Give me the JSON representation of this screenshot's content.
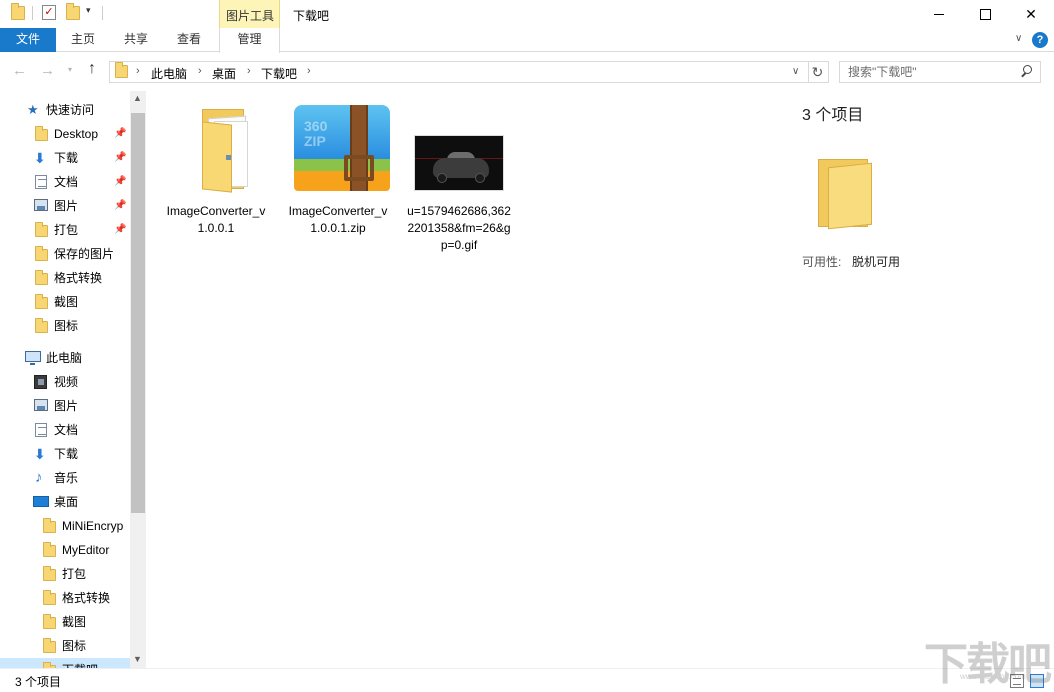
{
  "titlebar": {
    "context_tab_header": "图片工具",
    "window_title": "下载吧"
  },
  "ribbon": {
    "tabs": [
      {
        "label": "文件"
      },
      {
        "label": "主页"
      },
      {
        "label": "共享"
      },
      {
        "label": "查看"
      },
      {
        "label": "管理"
      }
    ],
    "help": "?"
  },
  "address": {
    "segments": [
      "此电脑",
      "桌面",
      "下载吧"
    ],
    "search_placeholder": "搜索\"下载吧\""
  },
  "sidebar": {
    "quick_access": {
      "label": "快速访问",
      "items": [
        {
          "label": "Desktop",
          "icon": "folder-icon",
          "pinned": true
        },
        {
          "label": "下载",
          "icon": "download-icon",
          "pinned": true
        },
        {
          "label": "文档",
          "icon": "document-icon",
          "pinned": true
        },
        {
          "label": "图片",
          "icon": "pictures-icon",
          "pinned": true
        },
        {
          "label": "打包",
          "icon": "folder-icon",
          "pinned": true
        },
        {
          "label": "保存的图片",
          "icon": "folder-icon",
          "pinned": false
        },
        {
          "label": "格式转换",
          "icon": "folder-icon",
          "pinned": false
        },
        {
          "label": "截图",
          "icon": "folder-icon",
          "pinned": false
        },
        {
          "label": "图标",
          "icon": "folder-icon",
          "pinned": false
        }
      ]
    },
    "this_pc": {
      "label": "此电脑",
      "items": [
        {
          "label": "视频",
          "icon": "video-icon"
        },
        {
          "label": "图片",
          "icon": "pictures-icon"
        },
        {
          "label": "文档",
          "icon": "document-icon"
        },
        {
          "label": "下载",
          "icon": "download-icon"
        },
        {
          "label": "音乐",
          "icon": "music-icon"
        },
        {
          "label": "桌面",
          "icon": "desktop-icon"
        }
      ]
    },
    "desktop_children": [
      {
        "label": "MiNiEncryp"
      },
      {
        "label": "MyEditor"
      },
      {
        "label": "打包"
      },
      {
        "label": "格式转换"
      },
      {
        "label": "截图"
      },
      {
        "label": "图标"
      },
      {
        "label": "下载吧"
      }
    ]
  },
  "files": [
    {
      "name": "ImageConverter_v1.0.0.1",
      "type": "folder"
    },
    {
      "name": "ImageConverter_v1.0.0.1.zip",
      "type": "zip"
    },
    {
      "name": "u=1579462686,3622201358&fm=26&gp=0.gif",
      "type": "gif"
    }
  ],
  "zip_badge": {
    "line1": "360",
    "line2": "ZIP"
  },
  "details": {
    "count": "3 个项目",
    "availability_label": "可用性:",
    "availability_value": "脱机可用"
  },
  "status": {
    "count": "3 个项目"
  },
  "watermark": {
    "text": "下载吧",
    "url": "www.xiazaiba.com"
  }
}
